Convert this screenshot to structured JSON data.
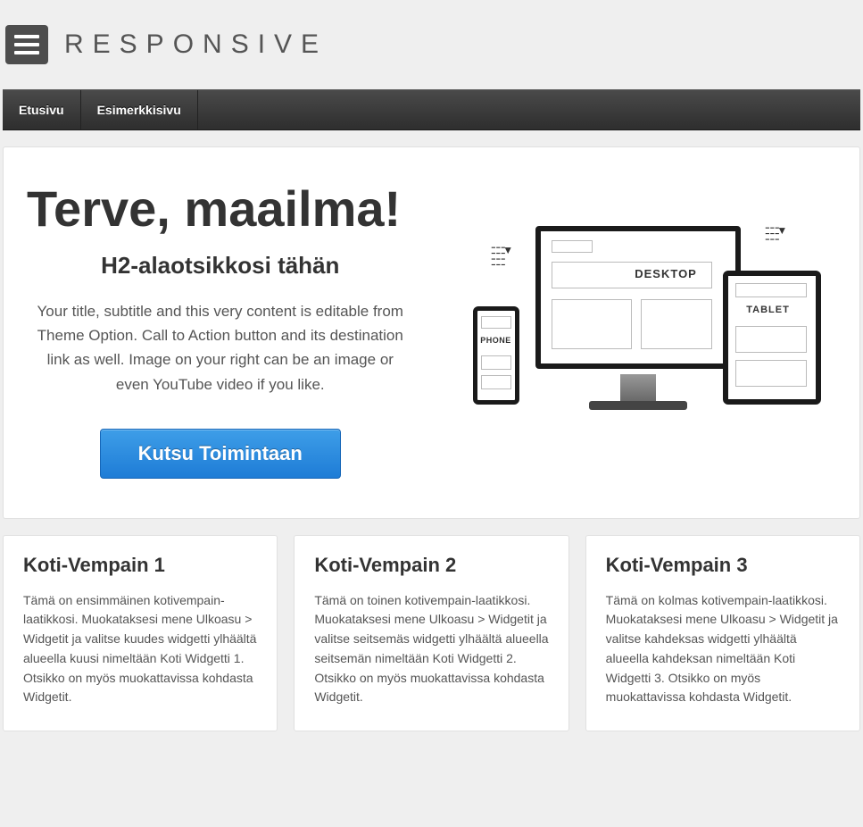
{
  "header": {
    "logo": "RESPONSIVE"
  },
  "nav": {
    "items": [
      "Etusivu",
      "Esimerkkisivu"
    ]
  },
  "hero": {
    "title": "Terve, maailma!",
    "subtitle": "H2-alaotsikkosi tähän",
    "body": "Your title, subtitle and this very content is editable from Theme Option. Call to Action button and its destination link as well. Image on your right can be an image or even YouTube video if you like.",
    "cta_label": "Kutsu Toimintaan",
    "device_labels": {
      "desktop": "DESKTOP",
      "tablet": "TABLET",
      "phone": "PHONE"
    }
  },
  "widgets": [
    {
      "title": "Koti-Vempain 1",
      "body": "Tämä on ensimmäinen kotivempain-laatikkosi. Muokataksesi mene Ulkoasu > Widgetit ja valitse kuudes widgetti ylhäältä alueella kuusi nimeltään Koti Widgetti 1. Otsikko on myös muokattavissa kohdasta Widgetit."
    },
    {
      "title": "Koti-Vempain 2",
      "body": "Tämä on toinen kotivempain-laatikkosi. Muokataksesi mene Ulkoasu > Widgetit ja valitse seitsemäs widgetti ylhäältä alueella seitsemän nimeltään Koti Widgetti 2. Otsikko on myös muokattavissa kohdasta Widgetit."
    },
    {
      "title": "Koti-Vempain 3",
      "body": "Tämä on kolmas kotivempain-laatikkosi. Muokataksesi mene Ulkoasu > Widgetit ja valitse kahdeksas widgetti ylhäältä alueella kahdeksan nimeltään Koti Widgetti 3. Otsikko on myös muokattavissa kohdasta Widgetit."
    }
  ]
}
